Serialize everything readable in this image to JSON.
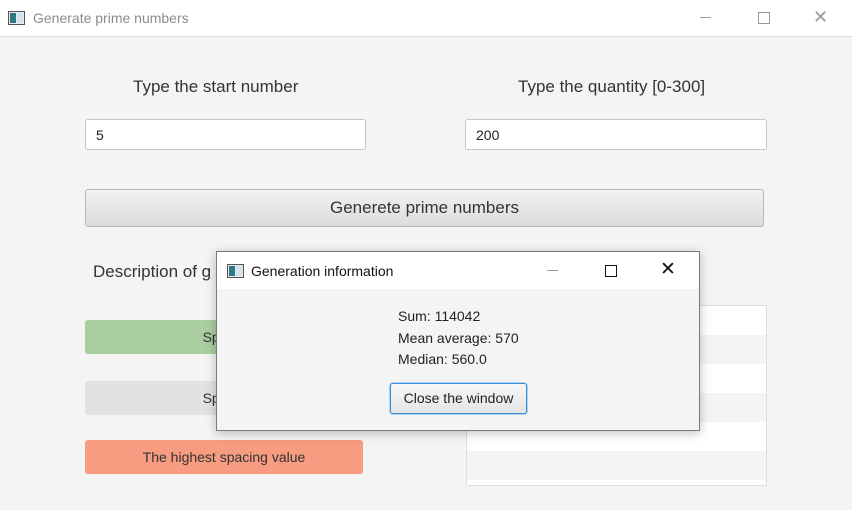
{
  "window": {
    "title": "Generate prime numbers",
    "minimize_glyph": "—",
    "close_glyph": "✕"
  },
  "form": {
    "start_label": "Type the start number",
    "start_value": "5",
    "quantity_label": "Type the quantity [0-300]",
    "quantity_value": "200",
    "generate_button": "Generete prime numbers",
    "description_label": "Description of g"
  },
  "legend": {
    "green_label": "Spacin",
    "grey_label": "Spacin",
    "red_label": "The highest spacing value",
    "colors": {
      "green": "#abcea0",
      "grey": "#e2e2e2",
      "red": "#f79c80"
    }
  },
  "list": {
    "rows": [
      "",
      "",
      "",
      "",
      "",
      ""
    ]
  },
  "dialog": {
    "title": "Generation information",
    "close_glyph": "✕",
    "sum_label": "Sum:  114042",
    "mean_label": "Mean average:  570",
    "median_label": "Median:  560.0",
    "close_button": "Close the window"
  }
}
